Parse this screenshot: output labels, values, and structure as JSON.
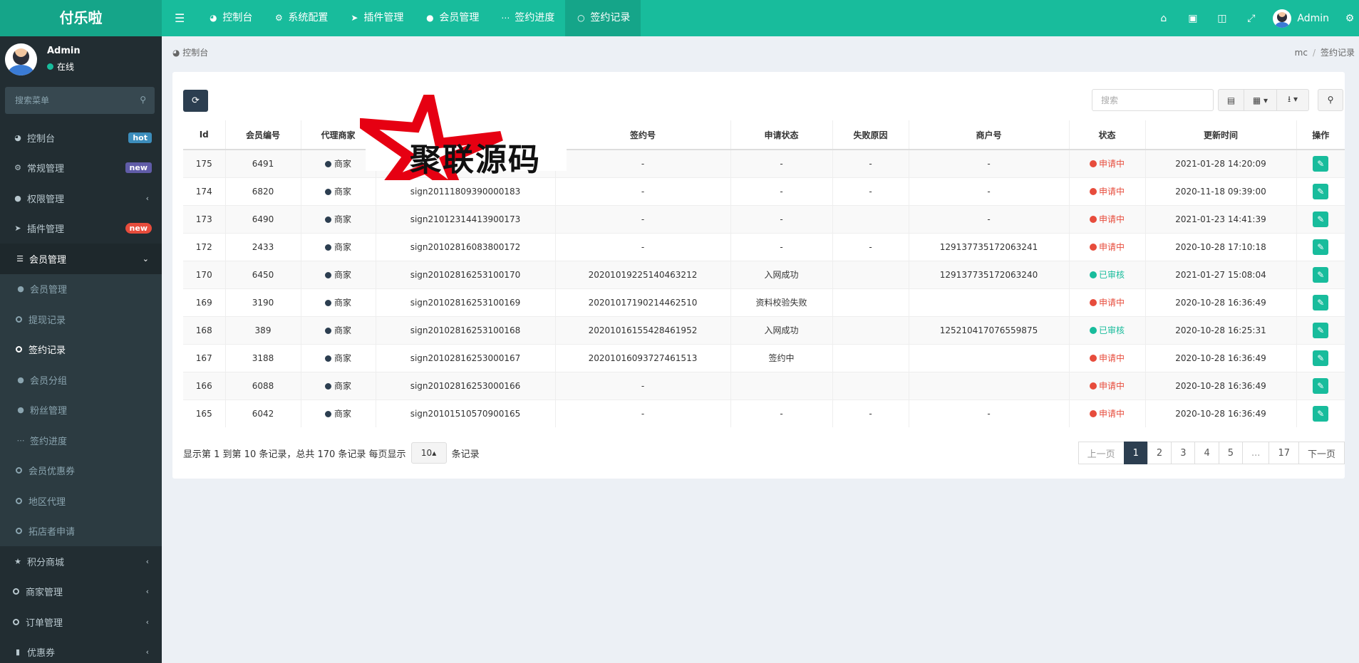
{
  "brand": "付乐啦",
  "topnav": {
    "toggle_icon": "menu-icon",
    "items": [
      {
        "label": "控制台",
        "icon": "dashboard-icon"
      },
      {
        "label": "系统配置",
        "icon": "gears-icon"
      },
      {
        "label": "插件管理",
        "icon": "rocket-icon"
      },
      {
        "label": "会员管理",
        "icon": "user-icon"
      },
      {
        "label": "签约进度",
        "icon": "ellipsis-icon"
      },
      {
        "label": "签约记录",
        "icon": "circle-icon"
      }
    ],
    "user": "Admin"
  },
  "sidebar": {
    "user_name": "Admin",
    "user_status": "在线",
    "search_placeholder": "搜索菜单",
    "items": [
      {
        "label": "控制台",
        "badge": "hot"
      },
      {
        "label": "常规管理",
        "badge": "new"
      },
      {
        "label": "权限管理"
      },
      {
        "label": "插件管理",
        "badge": "new"
      },
      {
        "label": "会员管理"
      }
    ],
    "sub_items": [
      {
        "label": "会员管理"
      },
      {
        "label": "提现记录"
      },
      {
        "label": "签约记录"
      },
      {
        "label": "会员分组"
      },
      {
        "label": "粉丝管理"
      },
      {
        "label": "签约进度"
      },
      {
        "label": "会员优惠券"
      },
      {
        "label": "地区代理"
      },
      {
        "label": "拓店者申请"
      }
    ],
    "bottom_items": [
      {
        "label": "积分商城"
      },
      {
        "label": "商家管理"
      },
      {
        "label": "订单管理"
      },
      {
        "label": "优惠券"
      }
    ]
  },
  "breadcrumb": {
    "left": "控制台",
    "right1": "mc",
    "sep": "/",
    "right2": "签约记录"
  },
  "toolbar": {
    "search_placeholder": "搜索"
  },
  "table": {
    "headers": [
      "Id",
      "会员编号",
      "代理商家",
      "",
      "签约号",
      "申请状态",
      "失败原因",
      "商户号",
      "状态",
      "更新时间",
      "操作"
    ],
    "rows": [
      [
        "175",
        "6491",
        "商家",
        "",
        "-",
        "-",
        "-",
        "-",
        "申请中",
        "2021-01-28 14:20:09"
      ],
      [
        "174",
        "6820",
        "商家",
        "sign20111809390000183",
        "-",
        "-",
        "-",
        "-",
        "申请中",
        "2020-11-18 09:39:00"
      ],
      [
        "173",
        "6490",
        "商家",
        "sign21012314413900173",
        "-",
        "-",
        "",
        "-",
        "申请中",
        "2021-01-23 14:41:39"
      ],
      [
        "172",
        "2433",
        "商家",
        "sign20102816083800172",
        "-",
        "-",
        "-",
        "129137735172063241",
        "申请中",
        "2020-10-28 17:10:18"
      ],
      [
        "170",
        "6450",
        "商家",
        "sign20102816253100170",
        "20201019225140463212",
        "入网成功",
        "",
        "129137735172063240",
        "已审核",
        "2021-01-27 15:08:04"
      ],
      [
        "169",
        "3190",
        "商家",
        "sign20102816253100169",
        "20201017190214462510",
        "资料校验失败",
        "",
        "",
        "申请中",
        "2020-10-28 16:36:49"
      ],
      [
        "168",
        "389",
        "商家",
        "sign20102816253100168",
        "20201016155428461952",
        "入网成功",
        "",
        "125210417076559875",
        "已审核",
        "2020-10-28 16:25:31"
      ],
      [
        "167",
        "3188",
        "商家",
        "sign20102816253000167",
        "20201016093727461513",
        "签约中",
        "",
        "",
        "申请中",
        "2020-10-28 16:36:49"
      ],
      [
        "166",
        "6088",
        "商家",
        "sign20102816253000166",
        "-",
        "",
        "",
        "",
        "申请中",
        "2020-10-28 16:36:49"
      ],
      [
        "165",
        "6042",
        "商家",
        "sign20101510570900165",
        "-",
        "-",
        "-",
        "-",
        "申请中",
        "2020-10-28 16:36:49"
      ]
    ]
  },
  "footer": {
    "summary": "显示第 1 到第 10 条记录，总共 170 条记录 每页显示",
    "page_size": "10",
    "summary_suffix": "条记录",
    "pages": [
      "上一页",
      "1",
      "2",
      "3",
      "4",
      "5",
      "...",
      "17",
      "下一页"
    ]
  },
  "watermark": "聚联源码",
  "colors": {
    "primary": "#18bc9c",
    "dark": "#2c3e50",
    "danger": "#e74c3c",
    "sidebar": "#222d32"
  }
}
